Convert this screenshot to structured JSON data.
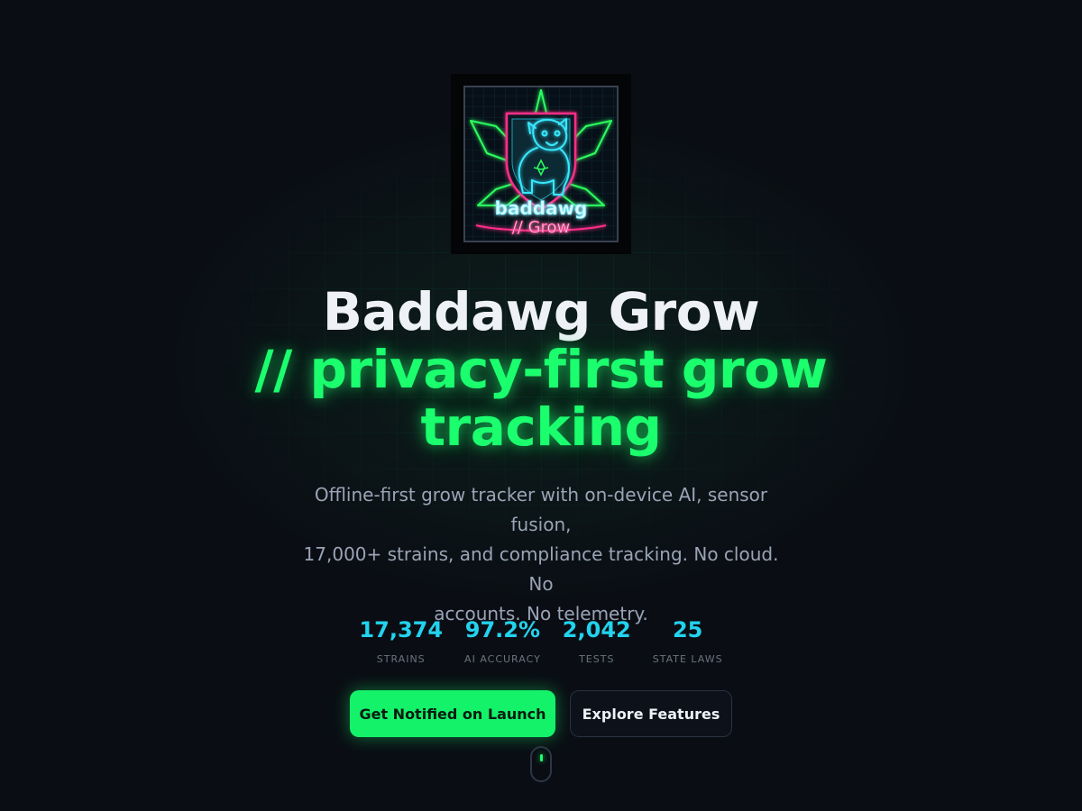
{
  "hero": {
    "logo_text": "baddawg",
    "logo_subtext": "// Grow",
    "title": "Baddawg Grow",
    "title_accent_line1": "// privacy-first grow",
    "title_accent_line2": "tracking",
    "subtitle_line1": "Offline-first grow tracker with on-device AI, sensor fusion,",
    "subtitle_line2": "17,000+ strains, and compliance tracking. No cloud. No",
    "subtitle_line3": "accounts. No telemetry."
  },
  "stats": [
    {
      "value": "17,374",
      "label": "STRAINS"
    },
    {
      "value": "97.2%",
      "label": "AI ACCURACY"
    },
    {
      "value": "2,042",
      "label": "TESTS"
    },
    {
      "value": "25",
      "label": "STATE LAWS"
    }
  ],
  "buttons": {
    "primary_label": "Get Notified on Launch",
    "secondary_label": "Explore Features"
  },
  "colors": {
    "background": "#0a0e14",
    "accent_green": "#1bff6e",
    "accent_cyan": "#22d3ee",
    "neon_pink": "#ff2e88",
    "primary_button": "#14f26a"
  },
  "icons": {
    "logo": "neon-bulldog-cannabis-leaf-logo",
    "scroll": "mouse-scroll-indicator-icon"
  }
}
